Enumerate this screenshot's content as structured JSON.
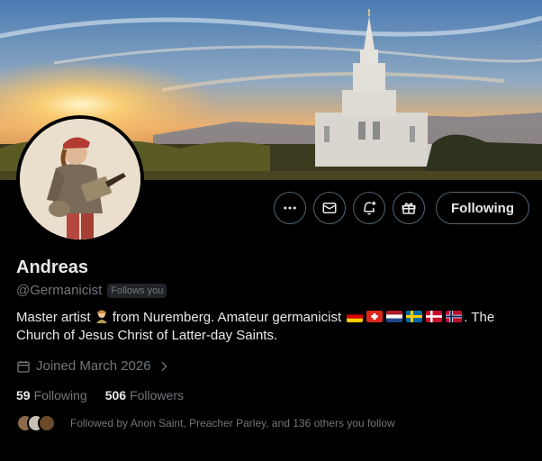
{
  "profile": {
    "name": "Andreas",
    "handle": "@Germanicist",
    "follows_you": "Follows you",
    "follow_button": "Following",
    "bio_part1": "Master artist ",
    "bio_part2": " from Nuremberg. Amateur germanicist ",
    "bio_part3": ". The Church of Jesus Christ of Latter-day Saints.",
    "joined": "Joined March 2026",
    "following_count": "59",
    "following_label": "Following",
    "followers_count": "506",
    "followers_label": "Followers",
    "followed_by": "Followed by Anon Saint, Preacher Parley, and 136 others you follow"
  },
  "actions": [
    {
      "name": "more",
      "icon": "more-icon"
    },
    {
      "name": "message",
      "icon": "mail-icon"
    },
    {
      "name": "notify",
      "icon": "bell-plus-icon"
    },
    {
      "name": "gift",
      "icon": "gift-icon"
    }
  ],
  "flags": [
    "germany",
    "switzerland",
    "netherlands",
    "sweden",
    "denmark",
    "norway"
  ],
  "colors": {
    "background": "#000000",
    "text": "#e7e9ea",
    "muted": "#71767b",
    "border": "#536471"
  }
}
